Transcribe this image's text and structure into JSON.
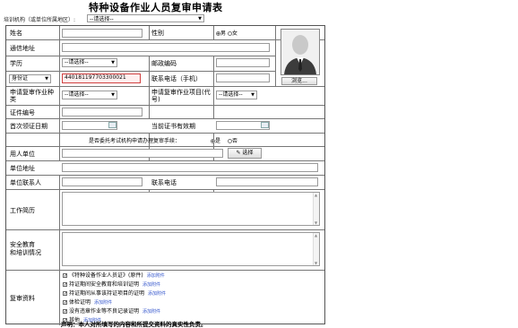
{
  "page_title": "特种设备作业人员复审申请表",
  "org": {
    "label": "培训机构（或单位所属地区）:",
    "select_value": "--请选择--"
  },
  "form": {
    "name_label": "姓名",
    "gender_label": "性别",
    "gender_options": [
      "男",
      "女"
    ],
    "address_label": "通信地址",
    "education_label": "学历",
    "education_value": "--请选择--",
    "postal_label": "邮政编码",
    "id_type_value": "身份证",
    "id_number_value": "440181197703300021",
    "phone_label": "联系电话（手机）",
    "review_type_label": "申请复审作业种类",
    "review_type_value": "--请选择--",
    "review_item_label": "申请复审作业项目(代号)",
    "review_item_value": "--请选择--",
    "cert_no_label": "证件编号",
    "first_issue_label": "首次领证日期",
    "valid_label": "当前证书有效期",
    "entrust_question": "是否委托考试机构申请办理复审手续：",
    "entrust_options": [
      "是",
      "否"
    ],
    "employer_label": "用人单位",
    "select_button": "选择",
    "employer_address_label": "单位地址",
    "employer_contact_label": "单位联系人",
    "contact_phone_label": "联系电话",
    "work_history_label": "工作简历",
    "safety_label_line1": "安全教育",
    "safety_label_line2": "和培训情况",
    "materials_label": "复审资料",
    "add_attachment": "添加附件",
    "materials": [
      "《特种设备作业人员证》(原件)",
      "持证期间安全教育和培训证明",
      "持证期间从事该持证项目的证明",
      "体检证明",
      "没有违章作业等不良记录证明",
      "其他"
    ],
    "declaration": "声明：本人对所填写的内容和所提交资料的真实性负责。"
  },
  "photo": {
    "browse_button": "浏览..."
  }
}
